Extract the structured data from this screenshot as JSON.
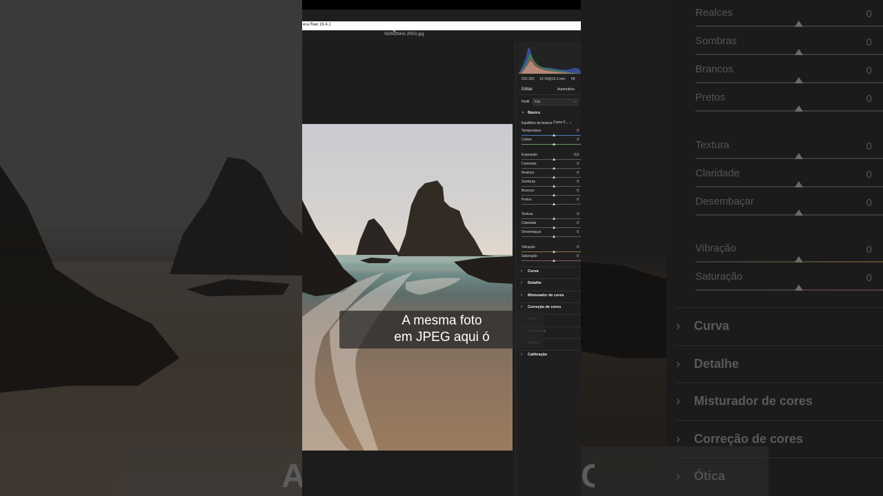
{
  "app": {
    "title": "era Raw 16.4.1",
    "file_name": "NORONHA JPEG.jpg",
    "cursor": "↖"
  },
  "histogram": {
    "iso": "ISO 320",
    "lens": "12-24@12.0 mm",
    "aperture": "f/8"
  },
  "panel": {
    "edit_label": "Editar",
    "auto_label": "Automático",
    "profile_label": "Perfil",
    "profile_value": "Cor",
    "chevron_down": "⌄",
    "basic_label": "Básico",
    "wb_label": "Equilíbrio de branco",
    "wb_value": "Como F... ⌄",
    "sliders": [
      {
        "label": "Temperatura",
        "value": "0",
        "color": "#4a7fb5"
      },
      {
        "label": "Colorir",
        "value": "0",
        "color": "#5fa05a"
      },
      {
        "label": "Exposição",
        "value": "0,0",
        "color": "#5a5a5a"
      },
      {
        "label": "Contraste",
        "value": "0",
        "color": "#5a5a5a"
      },
      {
        "label": "Realces",
        "value": "0",
        "color": "#5a5a5a"
      },
      {
        "label": "Sombras",
        "value": "0",
        "color": "#5a5a5a"
      },
      {
        "label": "Brancos",
        "value": "0",
        "color": "#5a5a5a"
      },
      {
        "label": "Pretos",
        "value": "0",
        "color": "#5a5a5a"
      },
      {
        "label": "Textura",
        "value": "0",
        "color": "#5a5a5a"
      },
      {
        "label": "Claridade",
        "value": "0",
        "color": "#5a5a5a"
      },
      {
        "label": "Desembaçar",
        "value": "0",
        "color": "#5a5a5a"
      },
      {
        "label": "Vibração",
        "value": "0",
        "color": "#8a7a3a"
      },
      {
        "label": "Saturação",
        "value": "0",
        "color": "#8a5a5a"
      }
    ],
    "sections": [
      {
        "label": "Curva",
        "dim": false
      },
      {
        "label": "Detalhe",
        "dim": false
      },
      {
        "label": "Misturador de cores",
        "dim": false
      },
      {
        "label": "Correção de cores",
        "dim": false
      },
      {
        "label": "Ótica",
        "dim": true
      },
      {
        "label": "Geometria",
        "dim": true
      },
      {
        "label": "Efeitos",
        "dim": true
      },
      {
        "label": "Calibração",
        "dim": false
      }
    ],
    "chevron_right": "›",
    "chevron_open": "⌄"
  },
  "background_panel": {
    "sliders": [
      {
        "label": "Realces",
        "value": "0"
      },
      {
        "label": "Sombras",
        "value": "0"
      },
      {
        "label": "Brancos",
        "value": "0"
      },
      {
        "label": "Pretos",
        "value": "0"
      },
      {
        "label": "Textura",
        "value": "0"
      },
      {
        "label": "Claridade",
        "value": "0"
      },
      {
        "label": "Desembaçar",
        "value": "0"
      },
      {
        "label": "Vibração",
        "value": "0"
      },
      {
        "label": "Saturação",
        "value": "0"
      }
    ],
    "sections": [
      "Curva",
      "Detalhe",
      "Misturador de cores",
      "Correção de cores",
      "Ótica"
    ]
  },
  "caption": {
    "line1": "A mesma foto",
    "line2": "em JPEG aqui ó"
  },
  "dim_caption": {
    "left": "A",
    "right": "O"
  },
  "colors": {
    "panel_bg": "#1f1f1f",
    "caption_text": "#ffffff"
  }
}
